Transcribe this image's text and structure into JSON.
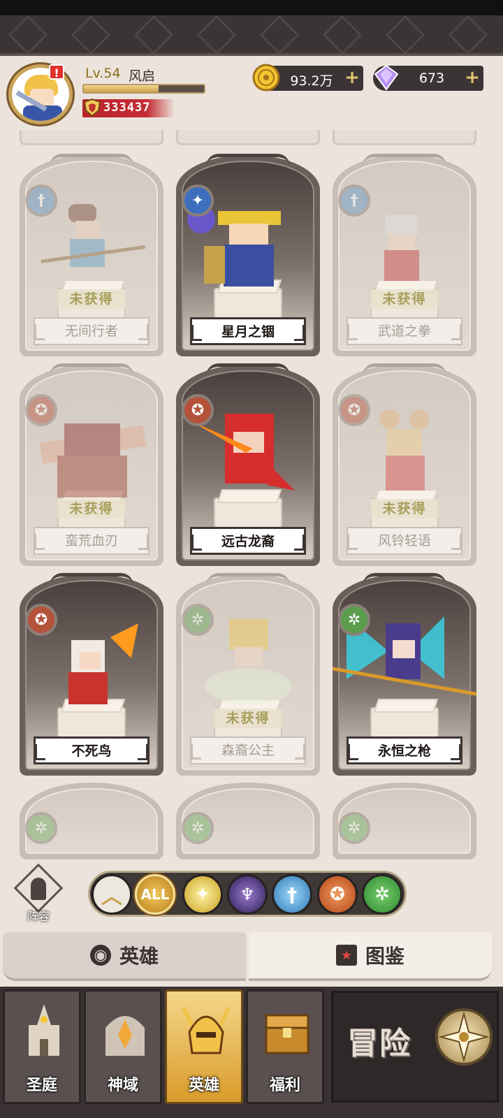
{
  "header": {
    "level": "Lv.54",
    "player_name": "风启",
    "exp_fraction": 0.62,
    "power": "333437",
    "alert": "!"
  },
  "currencies": {
    "gold": {
      "value": "93.2万",
      "icon": "gold-coin-icon",
      "plus": "+"
    },
    "gems": {
      "value": "673",
      "icon": "diamond-icon",
      "plus": "+"
    }
  },
  "not_owned_label": "未获得",
  "heroes": [
    {
      "name": "无间行者",
      "owned": false,
      "class_icon": "blade-class-icon"
    },
    {
      "name": "星月之锢",
      "owned": true,
      "class_icon": "star-class-icon"
    },
    {
      "name": "武道之拳",
      "owned": false,
      "class_icon": "blade-class-icon"
    },
    {
      "name": "蛮荒血刃",
      "owned": false,
      "class_icon": "wolf-class-icon"
    },
    {
      "name": "远古龙裔",
      "owned": true,
      "class_icon": "wolf-class-icon"
    },
    {
      "name": "风铃轻语",
      "owned": false,
      "class_icon": "wolf-class-icon"
    },
    {
      "name": "不死鸟",
      "owned": true,
      "class_icon": "wolf-class-icon"
    },
    {
      "name": "森裔公主",
      "owned": false,
      "class_icon": "tree-class-icon"
    },
    {
      "name": "永恒之枪",
      "owned": true,
      "class_icon": "tree-class-icon"
    }
  ],
  "filters": {
    "collapse_symbol": "︿",
    "all_label": "ALL",
    "lineup_label": "阵容"
  },
  "tabs": {
    "heroes": "英雄",
    "codex": "图鉴"
  },
  "nav": {
    "items": [
      "圣庭",
      "神域",
      "英雄",
      "福利"
    ],
    "active_index": 2,
    "adventure": "冒险"
  }
}
